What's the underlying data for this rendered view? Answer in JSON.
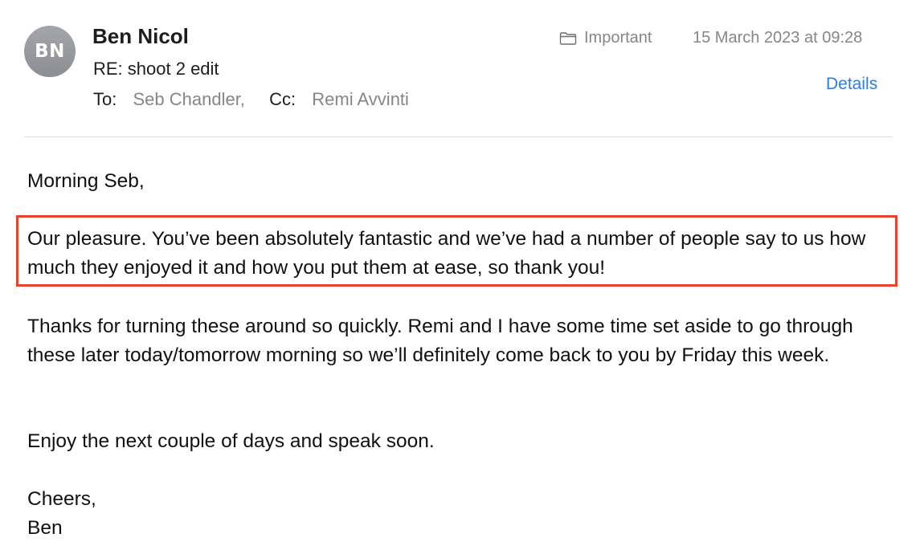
{
  "header": {
    "avatar_initials": "BN",
    "sender_name": "Ben Nicol",
    "subject": "RE: shoot 2 edit",
    "to_label": "To:",
    "to_value": "Seb Chandler,",
    "cc_label": "Cc:",
    "cc_value": "Remi Avvinti",
    "mailbox_icon": "folder-icon",
    "mailbox": "Important",
    "date": "15 March 2023 at 09:28",
    "details_link": "Details"
  },
  "body": {
    "greeting": "Morning Seb,",
    "paragraphs": [
      "Our pleasure. You’ve been absolutely fantastic and we’ve had a number of people say to us how much they enjoyed it and how you put them at ease, so thank you!",
      "Thanks for turning these around so quickly. Remi and I have some time set aside to go through these later today/tomorrow morning so we’ll definitely come back to you by Friday this week.",
      "Enjoy the next couple of days and speak soon."
    ],
    "closing": "Cheers,",
    "signature": "Ben"
  },
  "colors": {
    "highlight_border": "#e8432d",
    "link": "#2f7de1",
    "secondary_text": "#85868a"
  }
}
